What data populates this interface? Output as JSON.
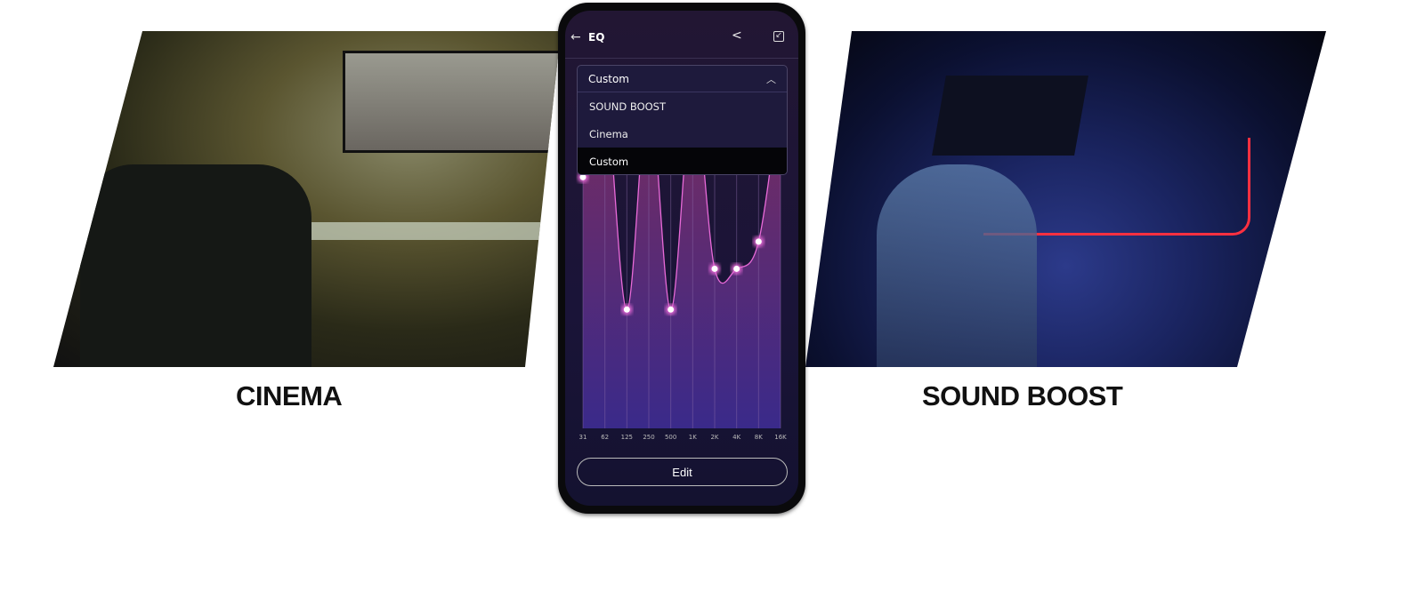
{
  "captions": {
    "left": "CINEMA",
    "right": "SOUND BOOST"
  },
  "app": {
    "title": "EQ",
    "back_icon": "arrow-left-icon",
    "share_icon": "share-icon",
    "save_icon": "save-icon"
  },
  "preset_dropdown": {
    "selected": "Custom",
    "expanded": true,
    "options": [
      "SOUND BOOST",
      "Cinema",
      "Custom"
    ],
    "highlighted": "Custom"
  },
  "edit_label": "Edit",
  "colors": {
    "curve": "#e86ad8",
    "fill_top": "#7a2c5e",
    "fill_bottom": "#3a2a8a",
    "point": "#ffffff"
  },
  "chart_data": {
    "type": "area",
    "categories": [
      "31",
      "62",
      "125",
      "250",
      "500",
      "1K",
      "2K",
      "4K",
      "8K",
      "16K"
    ],
    "values": [
      0.74,
      1.0,
      0.35,
      1.0,
      0.35,
      1.0,
      0.47,
      0.47,
      0.55,
      1.0
    ],
    "ylim": [
      0,
      1
    ],
    "grid": "vertical"
  }
}
